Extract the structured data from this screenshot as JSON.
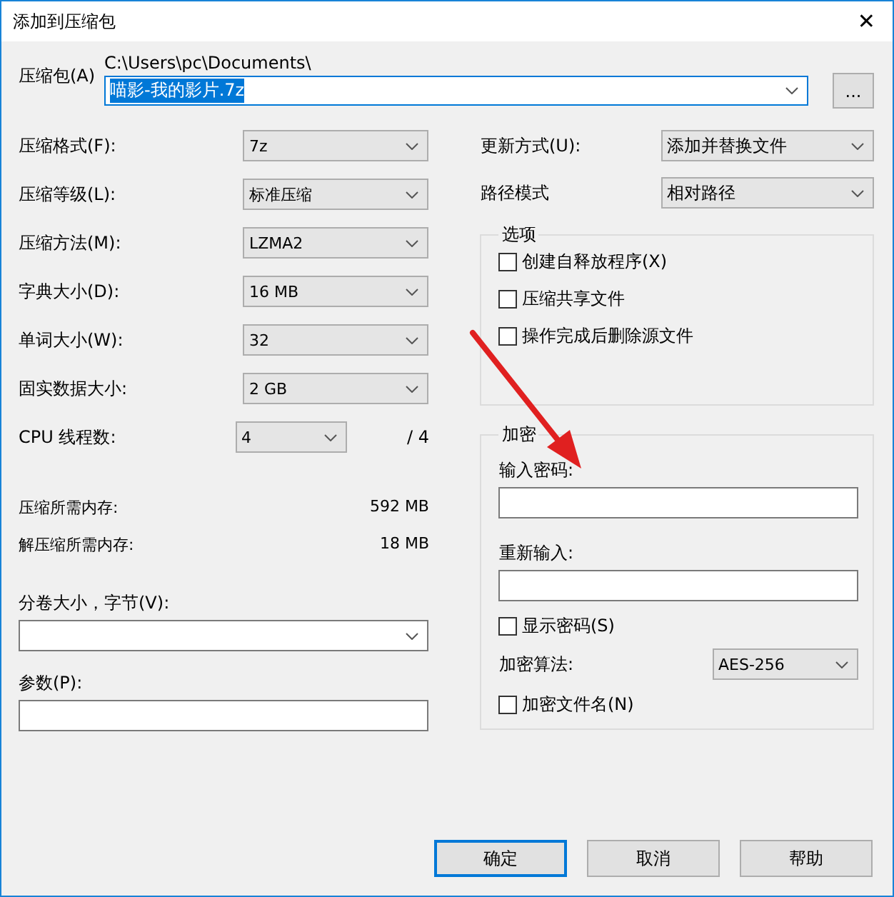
{
  "window": {
    "title": "添加到压缩包",
    "close": "✕"
  },
  "archive": {
    "label": "压缩包(A)",
    "path": "C:\\Users\\pc\\Documents\\",
    "value": "喵影-我的影片.7z",
    "text_selected": true,
    "browse": "..."
  },
  "settings": [
    {
      "label": "压缩格式(F):",
      "value": "7z"
    },
    {
      "label": "压缩等级(L):",
      "value": "标准压缩"
    },
    {
      "label": "压缩方法(M):",
      "value": "LZMA2"
    },
    {
      "label": "字典大小(D):",
      "value": "16 MB"
    },
    {
      "label": "单词大小(W):",
      "value": "32"
    },
    {
      "label": "固实数据大小:",
      "value": "2 GB"
    }
  ],
  "cpu": {
    "label": "CPU 线程数:",
    "value": "4",
    "max": "/ 4"
  },
  "memory": [
    {
      "label": "压缩所需内存:",
      "value": "592 MB"
    },
    {
      "label": "解压缩所需内存:",
      "value": "18 MB"
    }
  ],
  "volume": {
    "label": "分卷大小，字节(V):"
  },
  "parameters": {
    "label": "参数(P):"
  },
  "right_settings": [
    {
      "label": "更新方式(U):",
      "value": "添加并替换文件"
    },
    {
      "label": "路径模式",
      "value": "相对路径"
    }
  ],
  "options": {
    "title": "选项",
    "items": [
      {
        "label": "创建自释放程序(X)",
        "checked": false
      },
      {
        "label": "压缩共享文件",
        "checked": false
      },
      {
        "label": "操作完成后删除源文件",
        "checked": false
      }
    ]
  },
  "encryption": {
    "title": "加密",
    "password_label": "输入密码:",
    "reenter_label": "重新输入:",
    "show_password": {
      "label": "显示密码(S)",
      "checked": false
    },
    "method": {
      "label": "加密算法:",
      "value": "AES-256"
    },
    "encrypt_names": {
      "label": "加密文件名(N)",
      "checked": false
    }
  },
  "buttons": [
    {
      "label": "确定",
      "default": true
    },
    {
      "label": "取消",
      "default": false
    },
    {
      "label": "帮助",
      "default": false
    }
  ]
}
